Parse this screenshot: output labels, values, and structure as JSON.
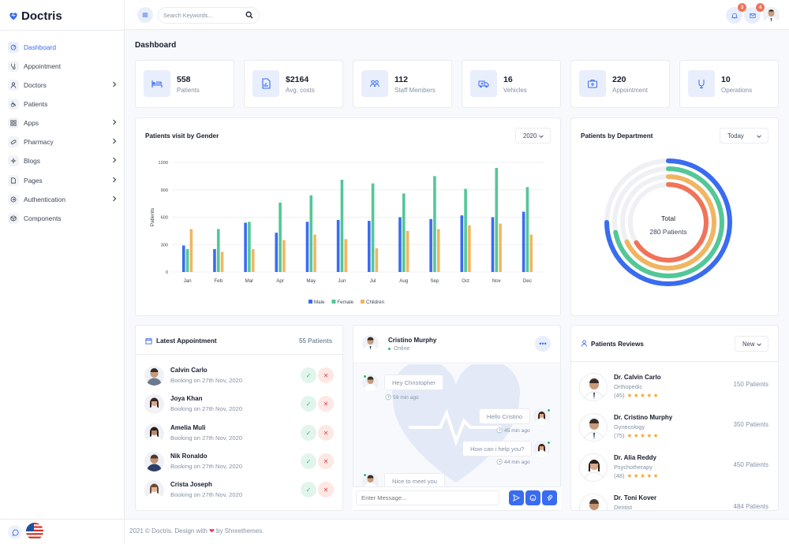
{
  "brand": {
    "name": "Doctris"
  },
  "sidebar": {
    "items": [
      {
        "label": "Dashboard",
        "icon": "dashboard-icon",
        "active": true
      },
      {
        "label": "Appointment",
        "icon": "stethoscope-icon"
      },
      {
        "label": "Doctors",
        "icon": "user-icon",
        "submenu": true
      },
      {
        "label": "Patients",
        "icon": "wheelchair-icon"
      },
      {
        "label": "Apps",
        "icon": "apps-icon",
        "submenu": true
      },
      {
        "label": "Pharmacy",
        "icon": "pill-icon",
        "submenu": true
      },
      {
        "label": "Blogs",
        "icon": "flower-icon",
        "submenu": true
      },
      {
        "label": "Pages",
        "icon": "file-icon",
        "submenu": true
      },
      {
        "label": "Authentication",
        "icon": "login-icon",
        "submenu": true
      },
      {
        "label": "Components",
        "icon": "cube-icon"
      }
    ]
  },
  "topbar": {
    "search_placeholder": "Search Keywords...",
    "notifications_count": "3",
    "mail_count": "4"
  },
  "page": {
    "title": "Dashboard"
  },
  "stats": [
    {
      "value": "558",
      "label": "Patients",
      "icon": "bed-icon"
    },
    {
      "value": "$2164",
      "label": "Avg. costs",
      "icon": "file-chart-icon"
    },
    {
      "value": "112",
      "label": "Staff Members",
      "icon": "users-icon"
    },
    {
      "value": "16",
      "label": "Vehicles",
      "icon": "ambulance-icon"
    },
    {
      "value": "220",
      "label": "Appointment",
      "icon": "medical-kit-icon"
    },
    {
      "value": "10",
      "label": "Operations",
      "icon": "syringe-icon"
    }
  ],
  "gender_chart": {
    "title": "Patients visit by Gender",
    "year": "2020"
  },
  "chart_data": [
    {
      "type": "bar",
      "title": "Patients visit by Gender",
      "ylabel": "Patients",
      "xlabel": "",
      "ylim": [
        0,
        1200
      ],
      "yticks": [
        0,
        300,
        600,
        900,
        1200
      ],
      "grid": true,
      "legend": "bottom",
      "categories": [
        "Jan",
        "Feb",
        "Mar",
        "Apr",
        "May",
        "Jun",
        "Jul",
        "Aug",
        "Sep",
        "Oct",
        "Nov",
        "Dec"
      ],
      "series": [
        {
          "name": "Male",
          "color": "#396cf0",
          "values": [
            290,
            250,
            540,
            430,
            550,
            570,
            560,
            600,
            580,
            620,
            600,
            660
          ]
        },
        {
          "name": "Female",
          "color": "#53c797",
          "values": [
            250,
            470,
            550,
            760,
            840,
            1010,
            970,
            860,
            1050,
            910,
            1140,
            930
          ]
        },
        {
          "name": "Children",
          "color": "#f1b561",
          "values": [
            470,
            220,
            250,
            350,
            410,
            360,
            260,
            450,
            470,
            510,
            530,
            410
          ]
        }
      ]
    },
    {
      "type": "radialBar",
      "title": "Patients by Department",
      "period": "Today",
      "center_label": "Total",
      "center_value": "280 Patients",
      "series": [
        {
          "color": "#396cf0",
          "fraction": 0.75
        },
        {
          "color": "#53c797",
          "fraction": 0.72
        },
        {
          "color": "#f1b561",
          "fraction": 0.68
        },
        {
          "color": "#f0735a",
          "fraction": 0.66
        }
      ]
    }
  ],
  "appointments": {
    "title": "Latest Appointment",
    "count": "55 Patients",
    "items": [
      {
        "name": "Calvin Carlo",
        "booking": "Booking on 27th Nov, 2020"
      },
      {
        "name": "Joya Khan",
        "booking": "Booking on 27th Nov, 2020"
      },
      {
        "name": "Amelia Muli",
        "booking": "Booking on 27th Nov, 2020"
      },
      {
        "name": "Nik Ronaldo",
        "booking": "Booking on 27th Nov, 2020"
      },
      {
        "name": "Crista Joseph",
        "booking": "Booking on 27th Nov, 2020"
      }
    ]
  },
  "chat": {
    "contact_name": "Cristino Murphy",
    "status": "Online",
    "messages": [
      {
        "text": "Hey Christopher",
        "time": "59 min ago",
        "side": "left"
      },
      {
        "text": "Hello Cristino",
        "time": "45 min ago",
        "side": "right"
      },
      {
        "text": "How can i help you?",
        "time": "44 min ago",
        "side": "right"
      },
      {
        "text": "Nice to meet you",
        "time": "",
        "side": "left"
      }
    ],
    "input_placeholder": "Enter Message..."
  },
  "reviews": {
    "title": "Patients Reviews",
    "filter": "New",
    "items": [
      {
        "name": "Dr. Calvin Carlo",
        "specialty": "Orthopedic",
        "rating_count": "(45)",
        "patients": "150 Patients"
      },
      {
        "name": "Dr. Cristino Murphy",
        "specialty": "Gynecology",
        "rating_count": "(75)",
        "patients": "350 Patients"
      },
      {
        "name": "Dr. Alia Reddy",
        "specialty": "Psychotherapy",
        "rating_count": "(48)",
        "patients": "450 Patients"
      },
      {
        "name": "Dr. Toni Kover",
        "specialty": "Dentist",
        "rating_count": "",
        "patients": "484 Patients"
      }
    ]
  },
  "footer": {
    "before": "2021 © Doctris. Design with",
    "heart": "❤",
    "after": "by Shreethemes."
  }
}
